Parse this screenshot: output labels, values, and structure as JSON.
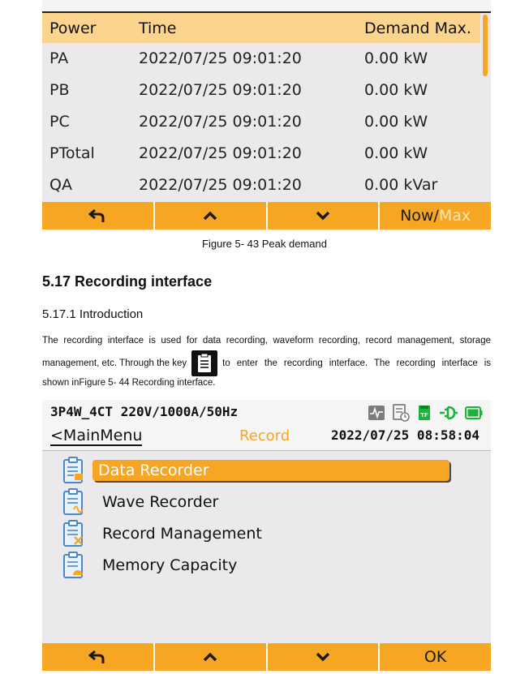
{
  "screen1": {
    "headers": [
      "Power",
      "Time",
      "Demand Max."
    ],
    "rows": [
      {
        "power": "PA",
        "time": "2022/07/25 09:01:20",
        "demand": "0.00 kW"
      },
      {
        "power": "PB",
        "time": "2022/07/25 09:01:20",
        "demand": "0.00 kW"
      },
      {
        "power": "PC",
        "time": "2022/07/25 09:01:20",
        "demand": "0.00 kW"
      },
      {
        "power": "PTotal",
        "time": "2022/07/25 09:01:20",
        "demand": "0.00 kW"
      },
      {
        "power": "QA",
        "time": "2022/07/25 09:01:20",
        "demand": "0.00 kVar"
      }
    ],
    "buttons": {
      "back_icon": "back-arrow-icon",
      "up_icon": "chevron-up-icon",
      "down_icon": "chevron-down-icon",
      "toggle_now": "Now/",
      "toggle_max": "Max"
    }
  },
  "doc": {
    "caption": "Figure 5- 43 Peak demand",
    "section_title": "5.17 Recording interface",
    "subsection_title": "5.17.1 Introduction",
    "para_line1": "The recording interface is used for data recording, waveform recording, record management, storage",
    "para_line2_a": "management, etc. Through the key",
    "para_line2_b": "to enter the recording interface. The recording interface is",
    "para_line3": "shown inFigure 5- 44 Recording interface."
  },
  "screen2": {
    "mode": "3P4W_4CT 220V/1000A/50Hz",
    "back_menu": "<MainMenu",
    "title": "Record",
    "datetime": "2022/07/25 08:58:04",
    "menu": [
      {
        "label": "Data Recorder",
        "icon": "data-recorder-icon",
        "selected": true
      },
      {
        "label": "Wave Recorder",
        "icon": "wave-recorder-icon",
        "selected": false
      },
      {
        "label": "Record Management",
        "icon": "record-management-icon",
        "selected": false
      },
      {
        "label": "Memory Capacity",
        "icon": "memory-capacity-icon",
        "selected": false
      }
    ],
    "ok_label": "OK"
  },
  "colors": {
    "accent": "#f6a623",
    "header_bg": "#fbd58e",
    "screen_bg": "#ebe9eb",
    "status_green": "#1db33a"
  }
}
